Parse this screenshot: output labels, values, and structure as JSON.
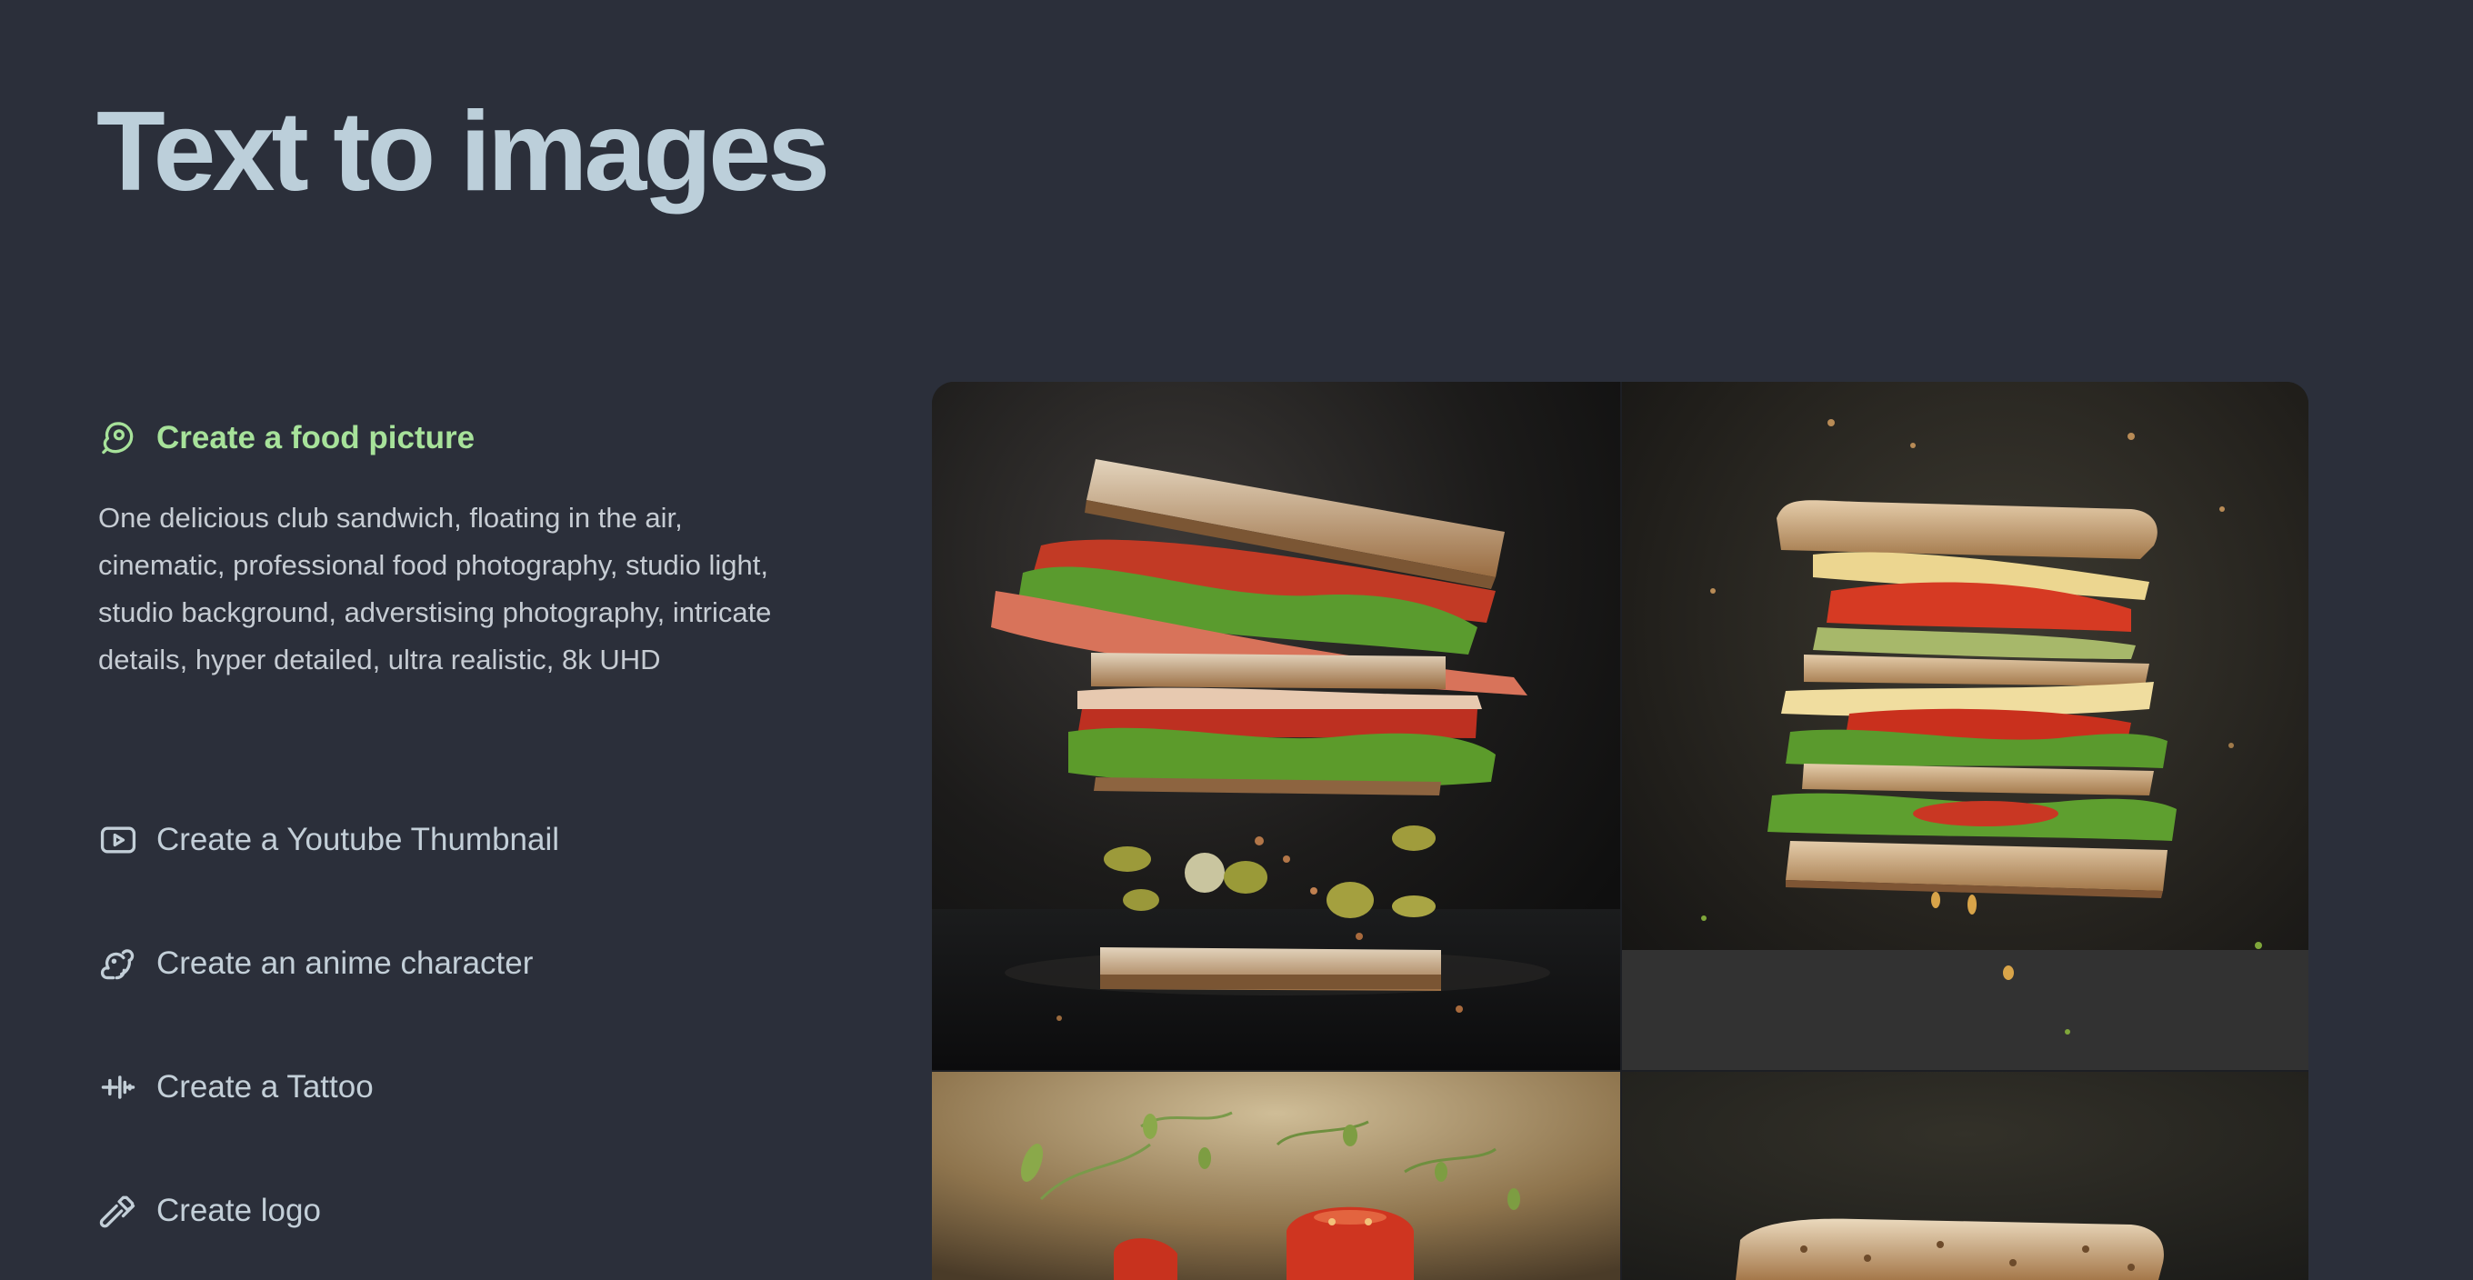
{
  "page": {
    "title": "Text to images"
  },
  "options": {
    "food": {
      "label": "Create a food picture",
      "icon": "ham-icon",
      "active": true,
      "prompt": "One delicious club sandwich, floating in the air, cinematic, professional food photography, studio light, studio background, adverstising photography, intricate details, hyper detailed, ultra realistic, 8k UHD"
    },
    "youtube": {
      "label": "Create a Youtube Thumbnail",
      "icon": "youtube-icon"
    },
    "anime": {
      "label": "Create an anime character",
      "icon": "squirrel-icon"
    },
    "tattoo": {
      "label": "Create a Tattoo",
      "icon": "tattoo-machine-icon"
    },
    "logo": {
      "label": "Create logo",
      "icon": "hammer-icon"
    }
  },
  "colors": {
    "background": "#2b2f3a",
    "title": "#bccfda",
    "active": "#a7e29a",
    "text": "#c3cfd8"
  },
  "gallery": {
    "images": [
      {
        "alt": "floating club sandwich with bacon, tomato and pickles on dark background"
      },
      {
        "alt": "stacked sandwich with cheese, tomato and lettuce, dark background"
      },
      {
        "alt": "tomatoes and microgreens floating on warm background"
      },
      {
        "alt": "toasted bread slice on dark background"
      }
    ]
  }
}
